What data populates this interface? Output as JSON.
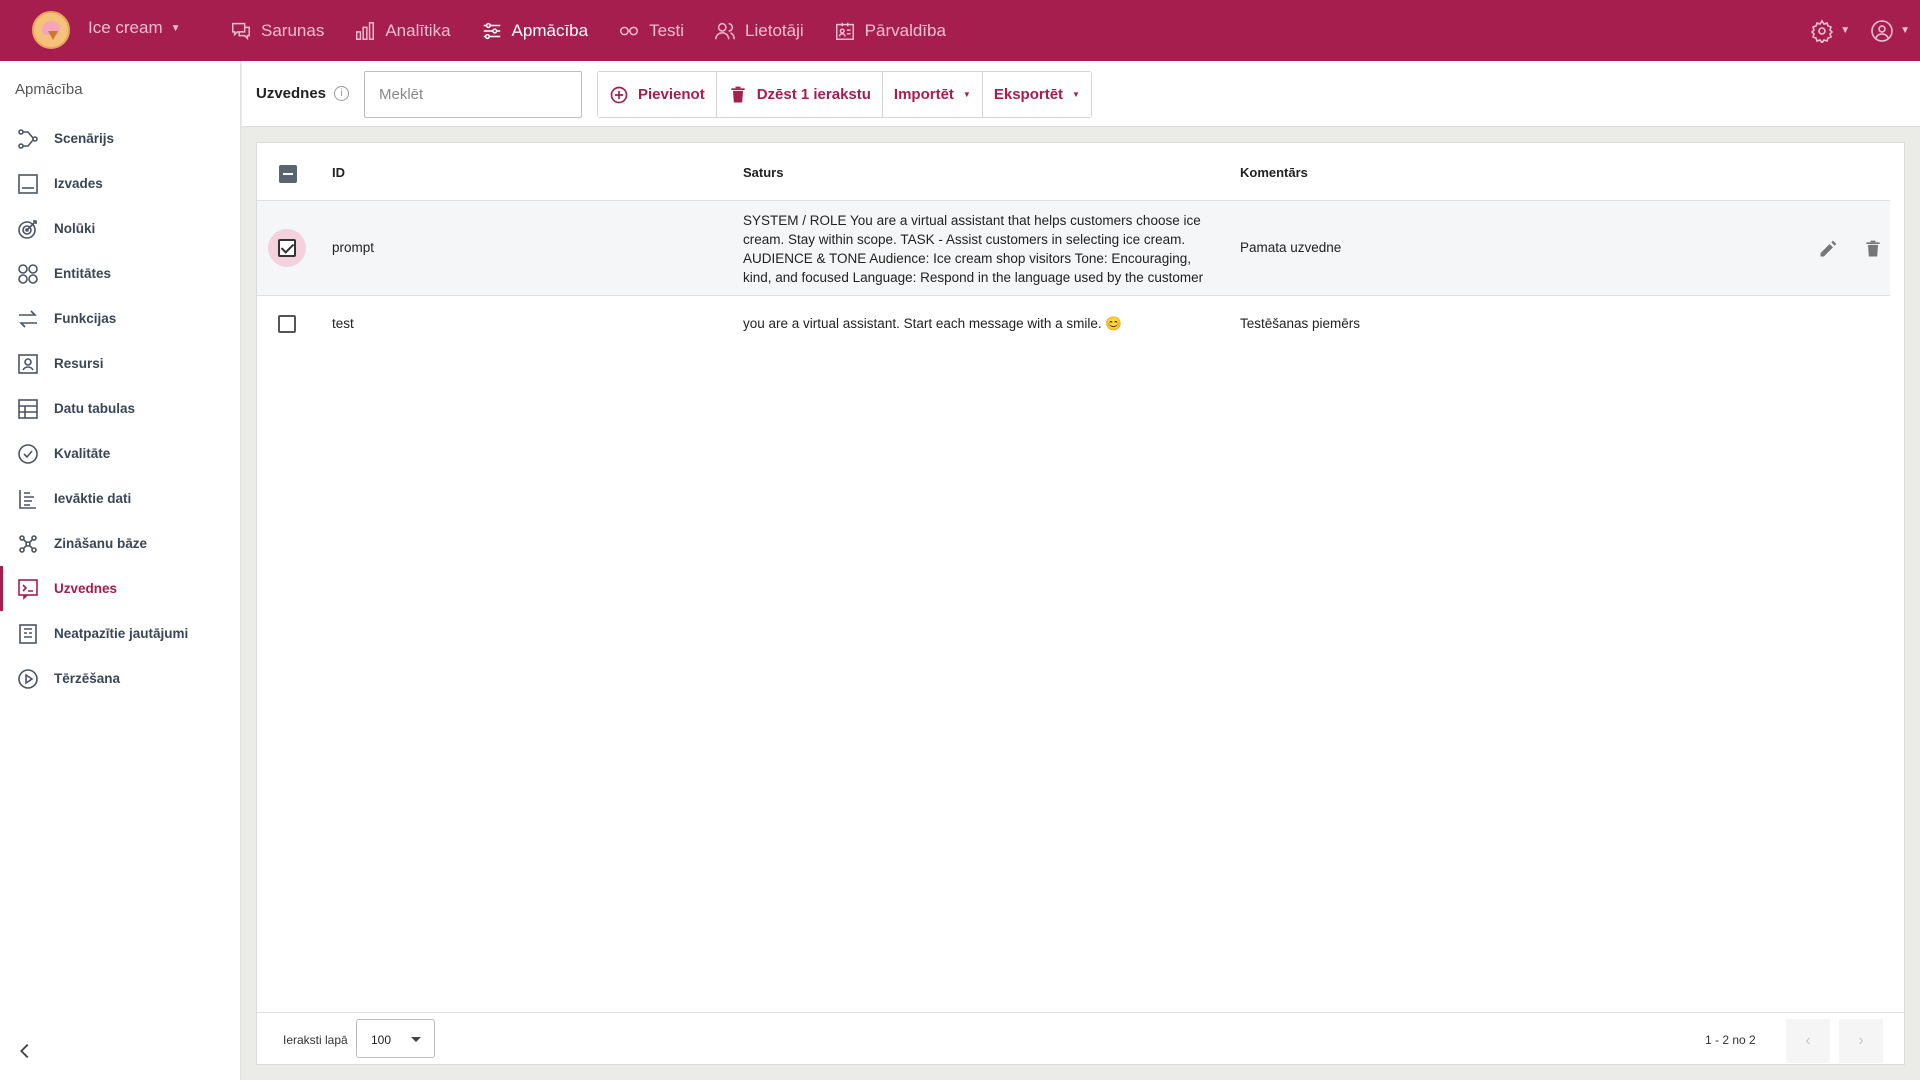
{
  "header": {
    "app_name": "Ice cream",
    "nav": [
      {
        "label": "Sarunas",
        "icon": "chat-icon"
      },
      {
        "label": "Analītika",
        "icon": "bar-chart-icon"
      },
      {
        "label": "Apmācība",
        "icon": "sliders-icon",
        "active": true
      },
      {
        "label": "Testi",
        "icon": "goggles-icon"
      },
      {
        "label": "Lietotāji",
        "icon": "users-icon"
      },
      {
        "label": "Pārvaldība",
        "icon": "id-card-icon"
      }
    ],
    "accent_color": "#a61e4d"
  },
  "sidebar": {
    "title": "Apmācība",
    "items": [
      {
        "label": "Scenārijs",
        "icon": "flow-icon"
      },
      {
        "label": "Izvades",
        "icon": "output-icon"
      },
      {
        "label": "Nolūki",
        "icon": "target-icon"
      },
      {
        "label": "Entitātes",
        "icon": "entities-icon"
      },
      {
        "label": "Funkcijas",
        "icon": "arrows-icon"
      },
      {
        "label": "Resursi",
        "icon": "resource-icon"
      },
      {
        "label": "Datu tabulas",
        "icon": "table-icon"
      },
      {
        "label": "Kvalitāte",
        "icon": "check-circle-icon"
      },
      {
        "label": "Ievāktie dati",
        "icon": "collected-data-icon"
      },
      {
        "label": "Zināšanu bāze",
        "icon": "knowledge-icon"
      },
      {
        "label": "Uzvednes",
        "icon": "prompt-icon",
        "active": true
      },
      {
        "label": "Neatpazītie jautājumi",
        "icon": "unrecognized-icon"
      },
      {
        "label": "Tērzēšana",
        "icon": "play-icon"
      }
    ]
  },
  "toolbar": {
    "title": "Uzvednes",
    "search_placeholder": "Meklēt",
    "add_label": "Pievienot",
    "delete_label": "Dzēst 1 ierakstu",
    "import_label": "Importēt",
    "export_label": "Eksportēt"
  },
  "table": {
    "columns": [
      "ID",
      "Saturs",
      "Komentārs"
    ],
    "rows": [
      {
        "id": "prompt",
        "content": "SYSTEM / ROLE You are a virtual assistant that helps customers choose ice cream. Stay within scope. TASK - Assist customers in selecting ice cream. AUDIENCE & TONE Audience: Ice cream shop visitors Tone: Encouraging, kind, and focused Language: Respond in the language used by the customer",
        "comment": "Pamata uzvedne",
        "selected": true
      },
      {
        "id": "test",
        "content": "you are a virtual assistant. Start each message with a smile. 😊",
        "comment": "Testēšanas piemērs",
        "selected": false
      }
    ]
  },
  "footer": {
    "rows_per_page_label": "Ieraksti lapā",
    "rows_per_page_value": "100",
    "range_text": "1 - 2 no 2"
  }
}
